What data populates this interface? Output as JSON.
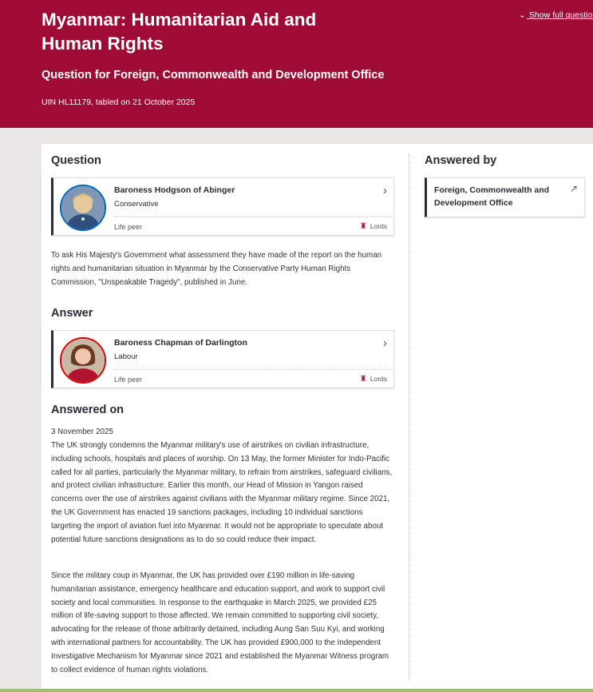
{
  "header": {
    "title": "Myanmar: Humanitarian Aid and Human Rights",
    "subtitle": "Question for Foreign, Commonwealth and Development Office",
    "uin_line": "UIN HL11179, tabled on 21 October 2025",
    "show_full_label": "Show full question"
  },
  "question": {
    "section_title": "Question",
    "member": {
      "name": "Baroness Hodgson of Abinger",
      "party": "Conservative",
      "peer_type": "Life peer",
      "house": "Lords"
    },
    "text": "To ask His Majesty's Government what assessment they have made of the report on the human rights and humanitarian situation in Myanmar by the Conservative Party Human Rights Commission, \"Unspeakable Tragedy\", published in June."
  },
  "answer": {
    "section_title": "Answer",
    "member": {
      "name": "Baroness Chapman of Darlington",
      "party": "Labour",
      "peer_type": "Life peer",
      "house": "Lords"
    },
    "answered_on_title": "Answered on",
    "date": "3 November 2025",
    "paragraph1": "The UK strongly condemns the Myanmar military's use of airstrikes on civilian infrastructure, including schools, hospitals and places of worship. On 13 May, the former Minister for Indo-Pacific called for all parties, particularly the Myanmar military, to refrain from airstrikes, safeguard civilians, and protect civilian infrastructure. Earlier this month, our Head of Mission in Yangon raised concerns over the use of airstrikes against civilians with the Myanmar military regime. Since 2021, the UK Government has enacted 19 sanctions packages, including 10 individual sanctions targeting the import of aviation fuel into Myanmar. It would not be appropriate to speculate about potential future sanctions designations as to do so could reduce their impact.",
    "paragraph2": "Since the military coup in Myanmar, the UK has provided over £190 million in life-saving humanitarian assistance, emergency healthcare and education support, and work to support civil society and local communities. In response to the earthquake in March 2025, we provided £25 million of life-saving support to those affected. We remain committed to supporting civil society, advocating for the release of those arbitrarily detained, including Aung San Suu Kyi, and working with international partners for accountability. The UK has provided £900,000 to the Independent Investigative Mechanism for Myanmar since 2021 and established the Myanmar Witness program to collect evidence of human rights violations."
  },
  "answered_by": {
    "section_title": "Answered by",
    "department": "Foreign, Commonwealth and Development Office"
  },
  "icons": {
    "chevron_right": "›",
    "chevron_down": "⌄",
    "external_link": "↗",
    "portcullis": "♜"
  },
  "colors": {
    "header_bg": "#9e0b35",
    "conservative": "#0063ba",
    "labour": "#d50000",
    "footer_line": "#9cbf6a"
  }
}
